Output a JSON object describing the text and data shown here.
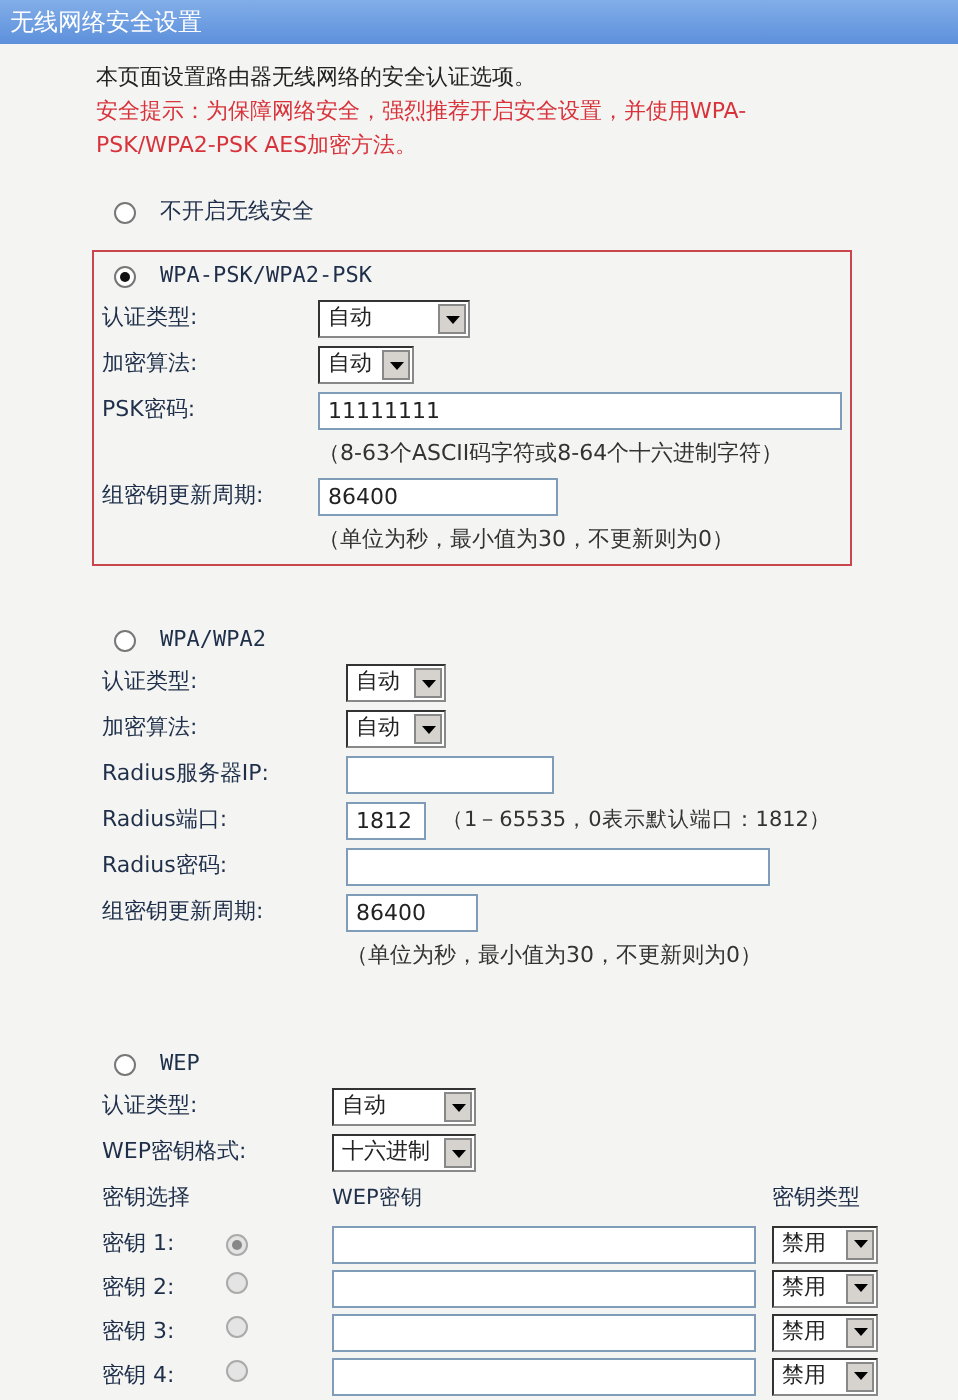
{
  "window": {
    "title": "无线网络安全设置"
  },
  "intro": "本页面设置路由器无线网络的安全认证选项。",
  "warning": "安全提示：为保障网络安全，强烈推荐开启安全设置，并使用WPA-PSK/WPA2-PSK AES加密方法。",
  "modes": [
    {
      "kind": "none",
      "label": "不开启无线安全",
      "selected": false
    },
    {
      "kind": "wpa_psk",
      "label": "WPA-PSK/WPA2-PSK",
      "selected": true,
      "fields": [
        {
          "kind": "select",
          "label": "认证类型:",
          "value": "自动"
        },
        {
          "kind": "select",
          "label": "加密算法:",
          "value": "自动"
        },
        {
          "kind": "text",
          "label": "PSK密码:",
          "value": "11111111"
        },
        {
          "kind": "hint",
          "text": "（8-63个ASCII码字符或8-64个十六进制字符）"
        },
        {
          "kind": "text",
          "label": "组密钥更新周期:",
          "value": "86400"
        },
        {
          "kind": "hint",
          "text": "（单位为秒，最小值为30，不更新则为0）"
        }
      ]
    },
    {
      "kind": "wpa",
      "label": "WPA/WPA2",
      "selected": false,
      "fields": [
        {
          "kind": "select",
          "label": "认证类型:",
          "value": "自动"
        },
        {
          "kind": "select",
          "label": "加密算法:",
          "value": "自动"
        },
        {
          "kind": "text",
          "label": "Radius服务器IP:"
        },
        {
          "kind": "text",
          "label": "Radius端口:",
          "value": "1812",
          "note": "（1－65535，0表示默认端口：1812）"
        },
        {
          "kind": "text",
          "label": "Radius密码:"
        },
        {
          "kind": "text",
          "label": "组密钥更新周期:",
          "value": "86400"
        },
        {
          "kind": "hint",
          "text": "（单位为秒，最小值为30，不更新则为0）"
        }
      ]
    },
    {
      "kind": "wep",
      "label": "WEP",
      "selected": false,
      "fields": [
        {
          "kind": "select",
          "label": "认证类型:",
          "value": "自动"
        },
        {
          "kind": "select",
          "label": "WEP密钥格式:",
          "value": "十六进制"
        }
      ],
      "key_table": {
        "columns": [
          "密钥选择",
          "WEP密钥",
          "密钥类型"
        ],
        "keys": [
          {
            "label": "密钥 1:",
            "selected": true,
            "disabled": true,
            "type": "禁用"
          },
          {
            "label": "密钥 2:",
            "selected": false,
            "disabled": true,
            "type": "禁用"
          },
          {
            "label": "密钥 3:",
            "selected": false,
            "disabled": true,
            "type": "禁用"
          },
          {
            "label": "密钥 4:",
            "selected": false,
            "disabled": true,
            "type": "禁用"
          }
        ]
      }
    }
  ]
}
